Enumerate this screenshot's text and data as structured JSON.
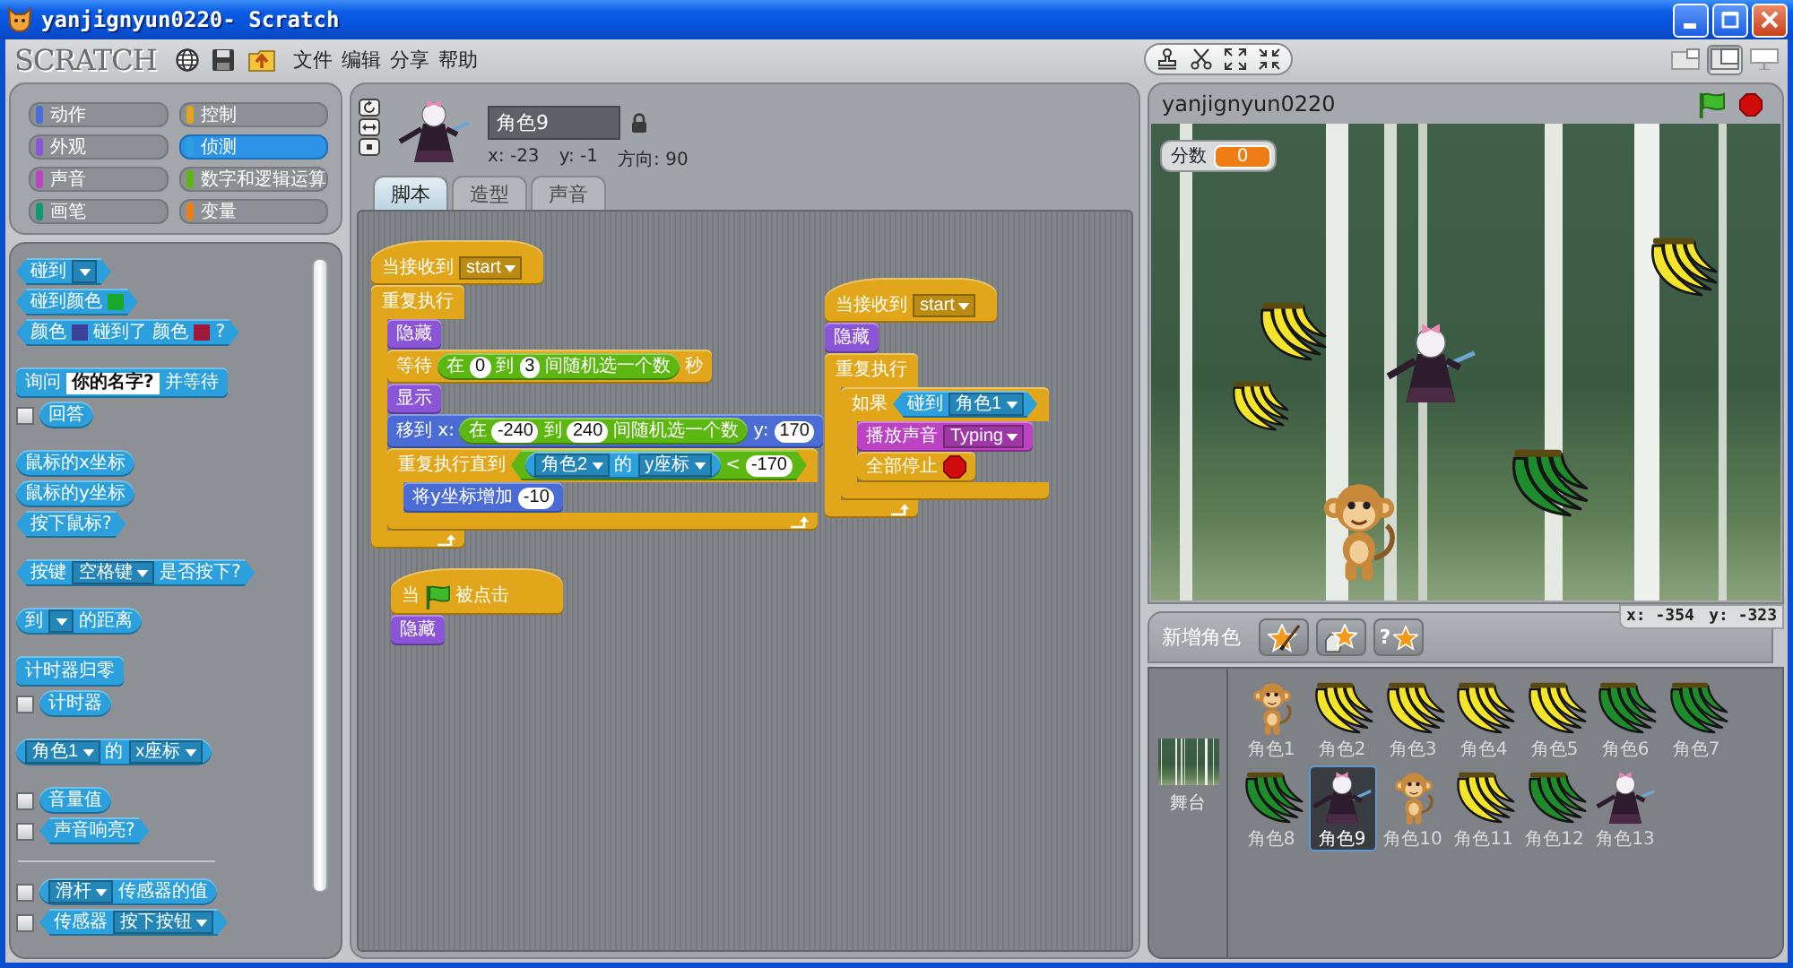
{
  "window": {
    "title": "yanjignyun0220- Scratch"
  },
  "menu": {
    "logo": "SCRATCH",
    "items": [
      "文件",
      "编辑",
      "分享",
      "帮助"
    ]
  },
  "view_buttons": [
    {
      "kind": "small_stage",
      "selected": false
    },
    {
      "kind": "normal_stage",
      "selected": true
    },
    {
      "kind": "presentation",
      "selected": false
    }
  ],
  "categories": [
    {
      "label": "动作",
      "color": "#4a6cd4",
      "selected": false
    },
    {
      "label": "控制",
      "color": "#e1a619",
      "selected": false
    },
    {
      "label": "外观",
      "color": "#8a55d7",
      "selected": false
    },
    {
      "label": "侦测",
      "color": "#2ca0dc",
      "selected": true
    },
    {
      "label": "声音",
      "color": "#bb42c3",
      "selected": false
    },
    {
      "label": "数字和逻辑运算",
      "color": "#5cb712",
      "selected": false
    },
    {
      "label": "画笔",
      "color": "#0e9a6c",
      "selected": false
    },
    {
      "label": "变量",
      "color": "#ee7d16",
      "selected": false
    }
  ],
  "palette": {
    "groups": [
      [
        {
          "kind": "boolean",
          "color": "#2ca0dc",
          "parts": [
            {
              "kind": "text",
              "text": "碰到"
            },
            {
              "kind": "dropdown"
            }
          ]
        },
        {
          "kind": "boolean",
          "color": "#2ca0dc",
          "parts": [
            {
              "kind": "text",
              "text": "碰到颜色"
            },
            {
              "kind": "swatch",
              "color": "#18a82c"
            }
          ]
        },
        {
          "kind": "boolean",
          "color": "#2ca0dc",
          "parts": [
            {
              "kind": "text",
              "text": "颜色"
            },
            {
              "kind": "swatch",
              "color": "#3d3f99"
            },
            {
              "kind": "text",
              "text": "碰到了 颜色"
            },
            {
              "kind": "swatch",
              "color": "#a0173a"
            },
            {
              "kind": "text",
              "text": "?"
            }
          ]
        }
      ],
      [
        {
          "kind": "command",
          "color": "#2ca0dc",
          "parts": [
            {
              "kind": "text",
              "text": "询问"
            },
            {
              "kind": "input",
              "text": "你的名字?"
            },
            {
              "kind": "text",
              "text": "并等待"
            }
          ]
        },
        {
          "kind": "reporter",
          "color": "#2ca0dc",
          "monitor": {
            "checked": false
          },
          "parts": [
            {
              "kind": "text",
              "text": "回答"
            }
          ]
        }
      ],
      [
        {
          "kind": "reporter",
          "color": "#2ca0dc",
          "parts": [
            {
              "kind": "text",
              "text": "鼠标的x坐标"
            }
          ]
        },
        {
          "kind": "reporter",
          "color": "#2ca0dc",
          "parts": [
            {
              "kind": "text",
              "text": "鼠标的y坐标"
            }
          ]
        },
        {
          "kind": "boolean",
          "color": "#2ca0dc",
          "parts": [
            {
              "kind": "text",
              "text": "按下鼠标?"
            }
          ]
        }
      ],
      [
        {
          "kind": "boolean",
          "color": "#2ca0dc",
          "parts": [
            {
              "kind": "text",
              "text": "按键"
            },
            {
              "kind": "dropdown",
              "text": "空格键"
            },
            {
              "kind": "text",
              "text": "是否按下?"
            }
          ]
        }
      ],
      [
        {
          "kind": "reporter",
          "color": "#2ca0dc",
          "parts": [
            {
              "kind": "text",
              "text": "到"
            },
            {
              "kind": "dropdown"
            },
            {
              "kind": "text",
              "text": "的距离"
            }
          ]
        }
      ],
      [
        {
          "kind": "command",
          "color": "#2ca0dc",
          "parts": [
            {
              "kind": "text",
              "text": "计时器归零"
            }
          ]
        },
        {
          "kind": "reporter",
          "color": "#2ca0dc",
          "monitor": {
            "checked": false
          },
          "parts": [
            {
              "kind": "text",
              "text": "计时器"
            }
          ]
        }
      ],
      [
        {
          "kind": "reporter",
          "color": "#2ca0dc",
          "parts": [
            {
              "kind": "dropdown",
              "text": "角色1"
            },
            {
              "kind": "text",
              "text": "的"
            },
            {
              "kind": "dropdown",
              "text": "x座标"
            }
          ]
        }
      ],
      [
        {
          "kind": "reporter",
          "color": "#2ca0dc",
          "monitor": {
            "checked": false
          },
          "parts": [
            {
              "kind": "text",
              "text": "音量值"
            }
          ]
        },
        {
          "kind": "boolean",
          "color": "#2ca0dc",
          "monitor": {
            "checked": false
          },
          "parts": [
            {
              "kind": "text",
              "text": "声音响亮?"
            }
          ]
        }
      ]
    ],
    "sensor_blocks": [
      {
        "kind": "reporter",
        "color": "#2ca0dc",
        "monitor": {
          "checked": false
        },
        "parts": [
          {
            "kind": "dropdown",
            "text": "滑杆"
          },
          {
            "kind": "text",
            "text": "传感器的值"
          }
        ]
      },
      {
        "kind": "boolean",
        "color": "#2ca0dc",
        "monitor": {
          "checked": false
        },
        "parts": [
          {
            "kind": "text",
            "text": "传感器"
          },
          {
            "kind": "dropdown",
            "text": "按下按钮"
          }
        ]
      }
    ]
  },
  "sprite_info": {
    "name": "角色9",
    "x": "x: -23",
    "y": "y: -1",
    "direction": "方向: 90"
  },
  "tabs": [
    {
      "label": "脚本",
      "selected": true
    },
    {
      "label": "造型",
      "selected": false
    },
    {
      "label": "声音",
      "selected": false
    }
  ],
  "scripts": [
    {
      "blocks": [
        {
          "kind": "hat",
          "color": "#e1a619",
          "parts": [
            {
              "kind": "text",
              "text": "当接收到"
            },
            {
              "kind": "dropdown",
              "text": "start"
            }
          ]
        },
        {
          "kind": "loop",
          "color": "#e1a619",
          "parts": [
            {
              "kind": "text",
              "text": "重复执行"
            }
          ],
          "children": [
            {
              "kind": "command",
              "color": "#8a55d7",
              "parts": [
                {
                  "kind": "text",
                  "text": "隐藏"
                }
              ]
            },
            {
              "kind": "command",
              "color": "#e1a619",
              "parts": [
                {
                  "kind": "text",
                  "text": "等待"
                },
                {
                  "kind": "reporter",
                  "color": "#5cb712",
                  "parts": [
                    {
                      "kind": "text",
                      "text": "在"
                    },
                    {
                      "kind": "number",
                      "text": "0"
                    },
                    {
                      "kind": "text",
                      "text": "到"
                    },
                    {
                      "kind": "number",
                      "text": "3"
                    },
                    {
                      "kind": "text",
                      "text": "间随机选一个数"
                    }
                  ]
                },
                {
                  "kind": "text",
                  "text": "秒"
                }
              ]
            },
            {
              "kind": "command",
              "color": "#8a55d7",
              "parts": [
                {
                  "kind": "text",
                  "text": "显示"
                }
              ]
            },
            {
              "kind": "command",
              "color": "#4a6cd4",
              "parts": [
                {
                  "kind": "text",
                  "text": "移到 x:"
                },
                {
                  "kind": "reporter",
                  "color": "#5cb712",
                  "parts": [
                    {
                      "kind": "text",
                      "text": "在"
                    },
                    {
                      "kind": "number",
                      "text": "-240"
                    },
                    {
                      "kind": "text",
                      "text": "到"
                    },
                    {
                      "kind": "number",
                      "text": "240"
                    },
                    {
                      "kind": "text",
                      "text": "间随机选一个数"
                    }
                  ]
                },
                {
                  "kind": "text",
                  "text": "y:"
                },
                {
                  "kind": "number",
                  "text": "170"
                }
              ]
            },
            {
              "kind": "loop",
              "color": "#e1a619",
              "parts": [
                {
                  "kind": "text",
                  "text": "重复执行直到"
                },
                {
                  "kind": "boolean",
                  "color": "#5cb712",
                  "parts": [
                    {
                      "kind": "reporter",
                      "color": "#2ca0dc",
                      "parts": [
                        {
                          "kind": "dropdown",
                          "text": "角色2"
                        },
                        {
                          "kind": "text",
                          "text": "的"
                        },
                        {
                          "kind": "dropdown",
                          "text": "y座标"
                        }
                      ]
                    },
                    {
                      "kind": "text",
                      "text": "<"
                    },
                    {
                      "kind": "number",
                      "text": "-170"
                    }
                  ]
                }
              ],
              "children": [
                {
                  "kind": "command",
                  "color": "#4a6cd4",
                  "parts": [
                    {
                      "kind": "text",
                      "text": "将y坐标增加"
                    },
                    {
                      "kind": "number",
                      "text": "-10"
                    }
                  ]
                }
              ]
            }
          ]
        }
      ]
    },
    {
      "blocks": [
        {
          "kind": "hat",
          "color": "#e1a619",
          "parts": [
            {
              "kind": "text",
              "text": "当"
            },
            {
              "kind": "flag"
            },
            {
              "kind": "text",
              "text": "被点击"
            }
          ]
        },
        {
          "kind": "command",
          "color": "#8a55d7",
          "parts": [
            {
              "kind": "text",
              "text": "隐藏"
            }
          ]
        }
      ]
    },
    {
      "blocks": [
        {
          "kind": "hat",
          "color": "#e1a619",
          "parts": [
            {
              "kind": "text",
              "text": "当接收到"
            },
            {
              "kind": "dropdown",
              "text": "start"
            }
          ]
        },
        {
          "kind": "command",
          "color": "#8a55d7",
          "parts": [
            {
              "kind": "text",
              "text": "隐藏"
            }
          ]
        },
        {
          "kind": "loop",
          "color": "#e1a619",
          "parts": [
            {
              "kind": "text",
              "text": "重复执行"
            }
          ],
          "children": [
            {
              "kind": "if",
              "color": "#e1a619",
              "parts": [
                {
                  "kind": "text",
                  "text": "如果"
                },
                {
                  "kind": "boolean",
                  "color": "#2ca0dc",
                  "parts": [
                    {
                      "kind": "text",
                      "text": "碰到"
                    },
                    {
                      "kind": "dropdown",
                      "text": "角色1"
                    }
                  ]
                }
              ],
              "children": [
                {
                  "kind": "command",
                  "color": "#bb42c3",
                  "parts": [
                    {
                      "kind": "text",
                      "text": "播放声音"
                    },
                    {
                      "kind": "dropdown",
                      "text": "Typing"
                    }
                  ]
                },
                {
                  "kind": "command",
                  "color": "#e1a619",
                  "parts": [
                    {
                      "kind": "text",
                      "text": "全部停止"
                    },
                    {
                      "kind": "stop"
                    }
                  ]
                }
              ]
            }
          ]
        }
      ]
    }
  ],
  "stage": {
    "title": "yanjignyun0220",
    "monitor": {
      "label": "分数",
      "value": "0"
    },
    "mouse_x": "x: -354",
    "mouse_y": "y: -323"
  },
  "sprite_panel": {
    "label": "新增角色",
    "surprise_mark": "?",
    "stage_label": "舞台",
    "sprites": [
      {
        "name": "角色1",
        "kind": "monkey",
        "selected": false
      },
      {
        "name": "角色2",
        "kind": "banana",
        "color": "#f4e52a",
        "selected": false
      },
      {
        "name": "角色3",
        "kind": "banana",
        "color": "#f4e52a",
        "selected": false
      },
      {
        "name": "角色4",
        "kind": "banana",
        "color": "#f4e52a",
        "selected": false
      },
      {
        "name": "角色5",
        "kind": "banana",
        "color": "#f4e52a",
        "selected": false
      },
      {
        "name": "角色6",
        "kind": "banana",
        "color": "#1e8c2a",
        "selected": false
      },
      {
        "name": "角色7",
        "kind": "banana",
        "color": "#1e8c2a",
        "selected": false
      },
      {
        "name": "角色8",
        "kind": "banana",
        "color": "#1e8c2a",
        "selected": false
      },
      {
        "name": "角色9",
        "kind": "witch",
        "selected": true
      },
      {
        "name": "角色10",
        "kind": "monkey",
        "selected": false
      },
      {
        "name": "角色11",
        "kind": "banana",
        "color": "#f4e52a",
        "selected": false
      },
      {
        "name": "角色12",
        "kind": "banana",
        "color": "#1e8c2a",
        "selected": false
      },
      {
        "name": "角色13",
        "kind": "witch",
        "selected": false
      }
    ]
  }
}
